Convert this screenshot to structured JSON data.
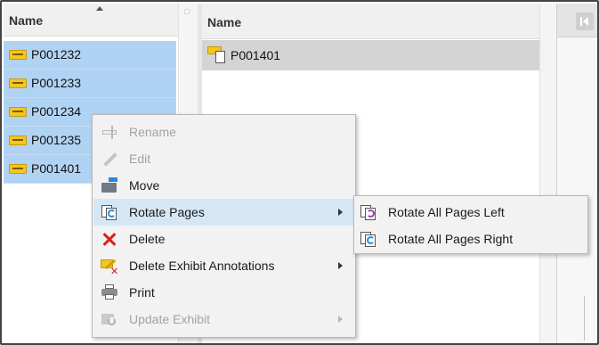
{
  "left_list": {
    "header": "Name",
    "items": [
      "P001232",
      "P001233",
      "P001234",
      "P001235",
      "P001401"
    ],
    "selection_color": "#b1d3f3"
  },
  "right_list": {
    "header": "Name",
    "items": [
      "P001401"
    ]
  },
  "context_menu": {
    "items": [
      {
        "label": "Rename",
        "icon": "rename-icon",
        "enabled": false,
        "submenu": false
      },
      {
        "label": "Edit",
        "icon": "pencil-icon",
        "enabled": false,
        "submenu": false
      },
      {
        "label": "Move",
        "icon": "move-folder-icon",
        "enabled": true,
        "submenu": false
      },
      {
        "label": "Rotate Pages",
        "icon": "rotate-pages-icon",
        "enabled": true,
        "submenu": true,
        "highlighted": true
      },
      {
        "label": "Delete",
        "icon": "delete-x-icon",
        "enabled": true,
        "submenu": false
      },
      {
        "label": "Delete Exhibit Annotations",
        "icon": "delete-annotations-icon",
        "enabled": true,
        "submenu": true
      },
      {
        "label": "Print",
        "icon": "printer-icon",
        "enabled": true,
        "submenu": false
      },
      {
        "label": "Update Exhibit",
        "icon": "update-exhibit-icon",
        "enabled": false,
        "submenu": true
      }
    ],
    "highlight_color": "#d5e7f5"
  },
  "rotate_submenu": {
    "items": [
      {
        "label": "Rotate All Pages Left",
        "icon": "rotate-left-icon"
      },
      {
        "label": "Rotate All Pages Right",
        "icon": "rotate-right-icon"
      }
    ]
  }
}
